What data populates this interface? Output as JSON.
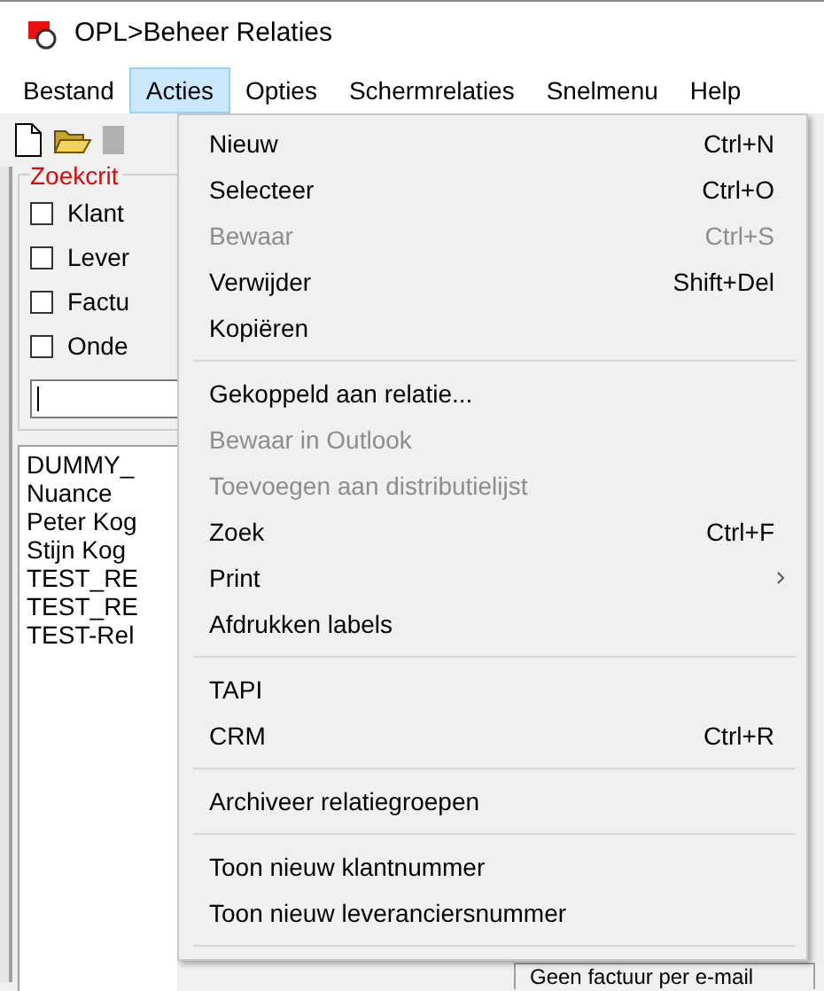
{
  "window": {
    "title": "OPL>Beheer Relaties"
  },
  "menubar": [
    {
      "label": "Bestand",
      "selected": false
    },
    {
      "label": "Acties",
      "selected": true
    },
    {
      "label": "Opties",
      "selected": false
    },
    {
      "label": "Schermrelaties",
      "selected": false
    },
    {
      "label": "Snelmenu",
      "selected": false
    },
    {
      "label": "Help",
      "selected": false
    }
  ],
  "search_group": {
    "title": "Zoekcrit",
    "checkboxes": [
      {
        "label": "Klant",
        "checked": false
      },
      {
        "label": "Lever",
        "checked": false
      },
      {
        "label": "Factu",
        "checked": false
      },
      {
        "label": "Onde",
        "checked": false
      }
    ]
  },
  "results": [
    "DUMMY_",
    "Nuance",
    "Peter Kog",
    "Stijn Kog",
    "TEST_RE",
    "TEST_RE",
    "TEST-Rel"
  ],
  "bottom_field": "Geen factuur per e-mail",
  "menu": [
    {
      "kind": "item",
      "label": "Nieuw",
      "shortcut": "Ctrl+N",
      "disabled": false
    },
    {
      "kind": "item",
      "label": "Selecteer",
      "shortcut": "Ctrl+O",
      "disabled": false
    },
    {
      "kind": "item",
      "label": "Bewaar",
      "shortcut": "Ctrl+S",
      "disabled": true
    },
    {
      "kind": "item",
      "label": "Verwijder",
      "shortcut": "Shift+Del",
      "disabled": false
    },
    {
      "kind": "item",
      "label": "Kopiëren",
      "disabled": false
    },
    {
      "kind": "separator"
    },
    {
      "kind": "item",
      "label": "Gekoppeld aan relatie...",
      "disabled": false
    },
    {
      "kind": "item",
      "label": "Bewaar in Outlook",
      "disabled": true
    },
    {
      "kind": "item",
      "label": "Toevoegen aan distributielijst",
      "disabled": true
    },
    {
      "kind": "item",
      "label": "Zoek",
      "shortcut": "Ctrl+F",
      "disabled": false
    },
    {
      "kind": "submenu",
      "label": "Print",
      "disabled": false
    },
    {
      "kind": "item",
      "label": "Afdrukken labels",
      "disabled": false
    },
    {
      "kind": "separator"
    },
    {
      "kind": "item",
      "label": "TAPI",
      "disabled": false
    },
    {
      "kind": "item",
      "label": "CRM",
      "shortcut": "Ctrl+R",
      "disabled": false
    },
    {
      "kind": "separator"
    },
    {
      "kind": "item",
      "label": "Archiveer relatiegroepen",
      "disabled": false
    },
    {
      "kind": "separator"
    },
    {
      "kind": "item",
      "label": "Toon nieuw klantnummer",
      "disabled": false
    },
    {
      "kind": "item",
      "label": "Toon nieuw leveranciersnummer",
      "disabled": false
    },
    {
      "kind": "separator"
    }
  ]
}
